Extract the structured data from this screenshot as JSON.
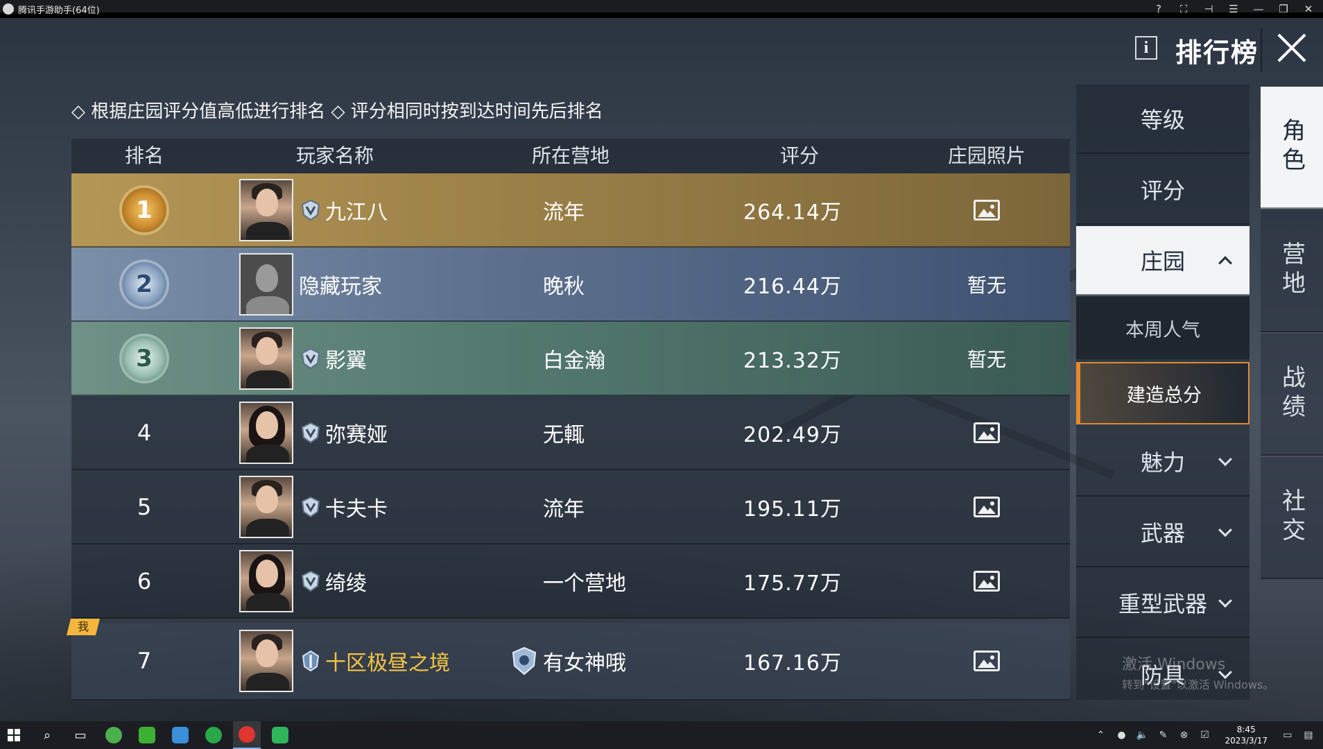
{
  "window": {
    "title": "腾讯手游助手(64位)"
  },
  "header": {
    "title": "排行榜",
    "info_label": "i"
  },
  "rules_text": "◇ 根据庄园评分值高低进行排名 ◇ 评分相同时按到达时间先后排名",
  "table": {
    "columns": [
      "排名",
      "玩家名称",
      "所在营地",
      "评分",
      "庄园照片"
    ],
    "rows": [
      {
        "rank": "1",
        "style": "gold",
        "name": "九江八",
        "camp": "流年",
        "score": "264.14万",
        "photo": "image",
        "avatar": "male"
      },
      {
        "rank": "2",
        "style": "silver",
        "name": "隐藏玩家",
        "camp": "晚秋",
        "score": "216.44万",
        "photo": "暂无",
        "avatar": "hidden"
      },
      {
        "rank": "3",
        "style": "bronze",
        "name": "影翼",
        "camp": "白金瀚",
        "score": "213.32万",
        "photo": "暂无",
        "avatar": "male"
      },
      {
        "rank": "4",
        "style": "plain",
        "name": "弥赛娅",
        "camp": "无輒",
        "score": "202.49万",
        "photo": "image",
        "avatar": "female"
      },
      {
        "rank": "5",
        "style": "plain",
        "name": "卡夫卡",
        "camp": "流年",
        "score": "195.11万",
        "photo": "image",
        "avatar": "male"
      },
      {
        "rank": "6",
        "style": "plain",
        "name": "绮绫",
        "camp": "一个营地",
        "score": "175.77万",
        "photo": "image",
        "avatar": "female"
      }
    ],
    "me": {
      "tag": "我",
      "rank": "7",
      "name": "十区极昼之境",
      "camp": "有女神哦",
      "score": "167.16万",
      "photo": "image"
    }
  },
  "categories": {
    "items": [
      {
        "label": "等级",
        "expandable": false
      },
      {
        "label": "评分",
        "expandable": false
      },
      {
        "label": "庄园",
        "expandable": true,
        "active": true
      },
      {
        "label": "魅力",
        "expandable": true
      },
      {
        "label": "武器",
        "expandable": true
      },
      {
        "label": "重型武器",
        "expandable": true
      },
      {
        "label": "防具",
        "expandable": true
      }
    ],
    "subitems": [
      {
        "label": "本周人气",
        "selected": false
      },
      {
        "label": "建造总分",
        "selected": true
      }
    ]
  },
  "side_tabs": [
    {
      "label": "角色",
      "active": true
    },
    {
      "label": "营地",
      "active": false
    },
    {
      "label": "战绩",
      "active": false
    },
    {
      "label": "社交",
      "active": false
    }
  ],
  "watermark": {
    "line1": "激活 Windows",
    "line2": "转到\"设置\"以激活 Windows。"
  },
  "taskbar": {
    "time": "8:45",
    "date": "2023/3/17"
  },
  "colors": {
    "gold_row": "#b59756",
    "silver_row": "#7c8fa9",
    "bronze_row": "#6f9186",
    "accent_orange": "#e38b2c",
    "me_name": "#f4c542"
  }
}
